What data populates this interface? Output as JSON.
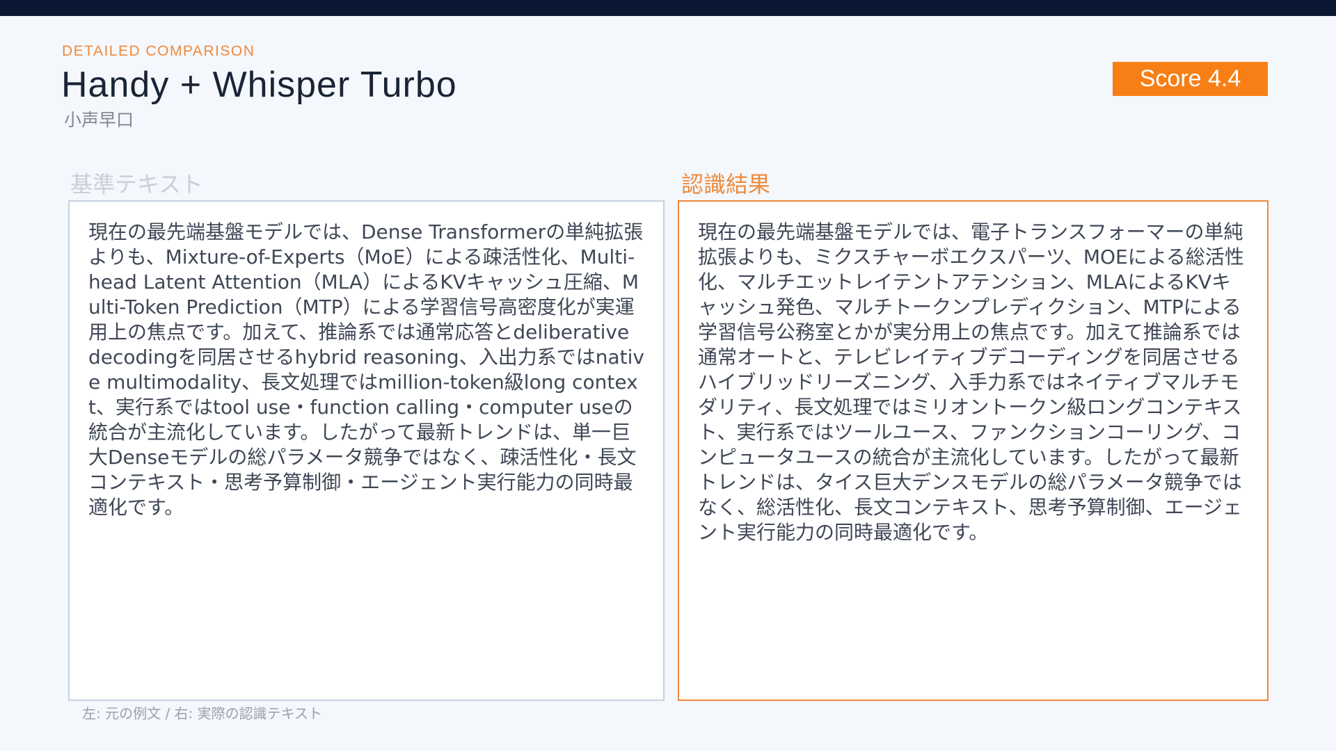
{
  "header": {
    "eyebrow": "DETAILED COMPARISON",
    "title": "Handy + Whisper Turbo",
    "subtitle": "小声早口",
    "score_label": "Score 4.4"
  },
  "reference": {
    "label": "基準テキスト",
    "text": "現在の最先端基盤モデルでは、Dense Transformerの単純拡張よりも、Mixture-of-Experts（MoE）による疎活性化、Multi-head Latent Attention（MLA）によるKVキャッシュ圧縮、Multi-Token Prediction（MTP）による学習信号高密度化が実運用上の焦点です。加えて、推論系では通常応答とdeliberative decodingを同居させるhybrid reasoning、入出力系ではnative multimodality、長文処理ではmillion-token級long context、実行系ではtool use・function calling・computer useの統合が主流化しています。したがって最新トレンドは、単一巨大Denseモデルの総パラメータ競争ではなく、疎活性化・長文コンテキスト・思考予算制御・エージェント実行能力の同時最適化です。"
  },
  "recognized": {
    "label": "認識結果",
    "text": "現在の最先端基盤モデルでは、電子トランスフォーマーの単純拡張よりも、ミクスチャーボエクスパーツ、MOEによる総活性化、マルチエットレイテントアテンション、MLAによるKVキャッシュ発色、マルチトークンプレディクション、MTPによる学習信号公務室とかが実分用上の焦点です。加えて推論系では通常オートと、テレビレイティブデコーディングを同居させるハイブリッドリーズニング、入手力系ではネイティブマルチモダリティ、長文処理ではミリオントークン級ロングコンテキスト、実行系ではツールユース、ファンクションコーリング、コンピュータユースの統合が主流化しています。したがって最新トレンドは、タイス巨大デンスモデルの総パラメータ競争ではなく、総活性化、長文コンテキスト、思考予算制御、エージェント実行能力の同時最適化です。"
  },
  "footnote": "左: 元の例文 / 右: 実際の認識テキスト",
  "colors": {
    "accent": "#f77f16",
    "top_bar": "#0c1733",
    "background": "#f4f7fb"
  }
}
